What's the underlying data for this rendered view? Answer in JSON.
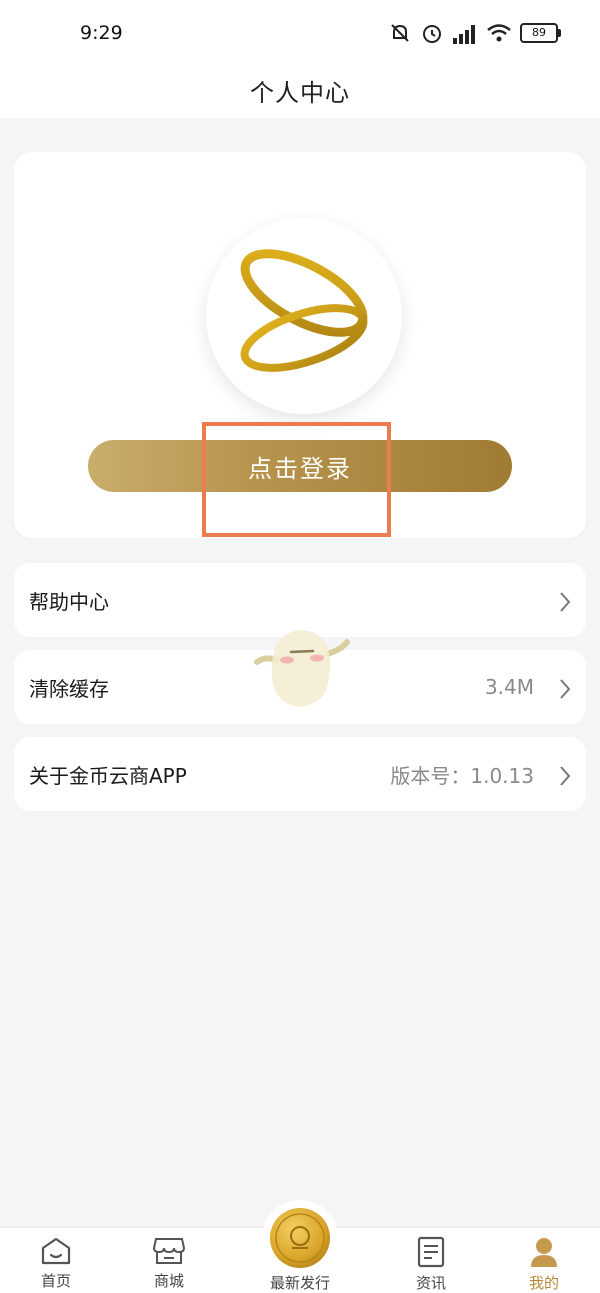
{
  "status_bar": {
    "time": "9:29",
    "battery": "89"
  },
  "header": {
    "title": "个人中心"
  },
  "profile": {
    "login_label": "点击登录"
  },
  "menu": [
    {
      "label": "帮助中心",
      "value": ""
    },
    {
      "label": "清除缓存",
      "value": "3.4M"
    },
    {
      "label": "关于金币云商APP",
      "value": "版本号：1.0.13"
    }
  ],
  "tabs": [
    {
      "label": "首页",
      "icon": "home-icon"
    },
    {
      "label": "商城",
      "icon": "store-icon"
    },
    {
      "label": "最新发行",
      "icon": "gold-coin-icon"
    },
    {
      "label": "资讯",
      "icon": "news-icon"
    },
    {
      "label": "我的",
      "icon": "person-icon",
      "active": true
    }
  ],
  "colors": {
    "accent": "#b48a3a",
    "highlight": "#ec7c4d",
    "background": "#f5f5f5"
  }
}
